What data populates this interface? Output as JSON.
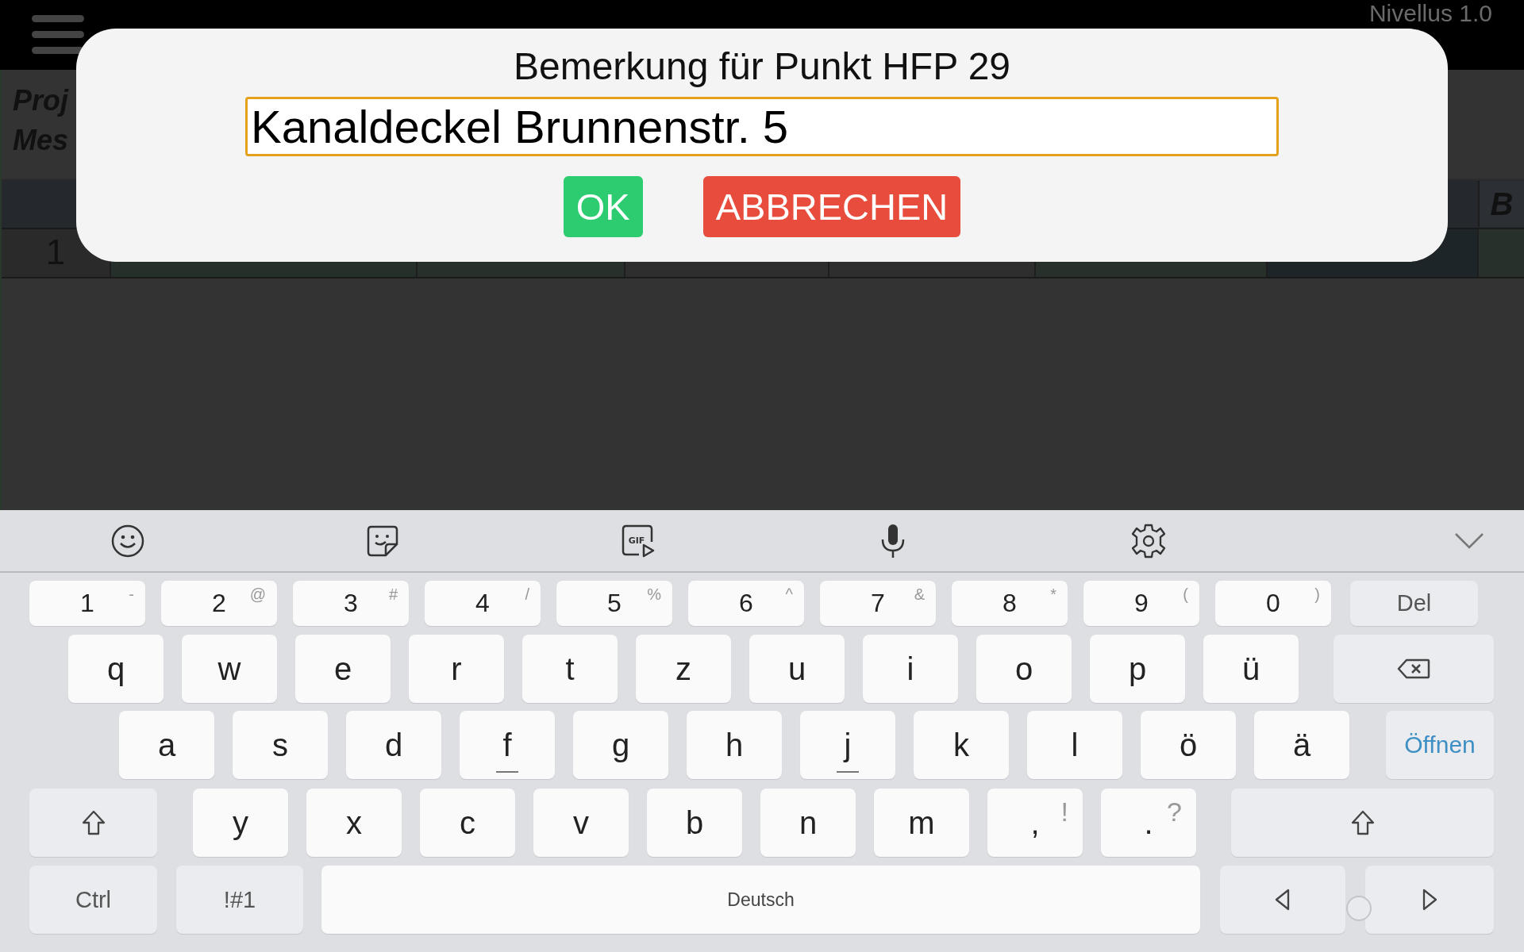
{
  "app_bar": {
    "title": "Nivellus 1.0"
  },
  "background": {
    "info_lines": [
      "Proj",
      "Mes"
    ],
    "header_cells": [
      "B"
    ],
    "row_number": "1"
  },
  "dialog": {
    "title": "Bemerkung für Punkt HFP 29",
    "value": "Kanaldeckel Brunnenstr. 5",
    "buttons": [
      {
        "label": "OK",
        "kind": "confirm"
      },
      {
        "label": "ABBRECHEN",
        "kind": "cancel"
      }
    ]
  },
  "keyboard_toolbar": [
    {
      "kind": "emoji"
    },
    {
      "kind": "sticker"
    },
    {
      "kind": "gif",
      "label": "GIF"
    },
    {
      "kind": "voice"
    },
    {
      "kind": "settings"
    },
    {
      "kind": "collapse"
    }
  ],
  "keyboard_rows": [
    [
      {
        "kind": "char",
        "label": "1",
        "hint": "-"
      },
      {
        "kind": "char",
        "label": "2",
        "hint": "@"
      },
      {
        "kind": "char",
        "label": "3",
        "hint": "#"
      },
      {
        "kind": "char",
        "label": "4",
        "hint": "/"
      },
      {
        "kind": "char",
        "label": "5",
        "hint": "%"
      },
      {
        "kind": "char",
        "label": "6",
        "hint": "^"
      },
      {
        "kind": "char",
        "label": "7",
        "hint": "&"
      },
      {
        "kind": "char",
        "label": "8",
        "hint": "*"
      },
      {
        "kind": "char",
        "label": "9",
        "hint": "("
      },
      {
        "kind": "char",
        "label": "0",
        "hint": ")"
      },
      {
        "kind": "func",
        "label": "Del"
      }
    ],
    [
      {
        "kind": "char",
        "label": "q"
      },
      {
        "kind": "char",
        "label": "w"
      },
      {
        "kind": "char",
        "label": "e"
      },
      {
        "kind": "char",
        "label": "r"
      },
      {
        "kind": "char",
        "label": "t"
      },
      {
        "kind": "char",
        "label": "z"
      },
      {
        "kind": "char",
        "label": "u"
      },
      {
        "kind": "char",
        "label": "i"
      },
      {
        "kind": "char",
        "label": "o"
      },
      {
        "kind": "char",
        "label": "p"
      },
      {
        "kind": "char",
        "label": "ü"
      },
      {
        "kind": "backspace"
      }
    ],
    [
      {
        "kind": "char",
        "label": "a"
      },
      {
        "kind": "char",
        "label": "s"
      },
      {
        "kind": "char",
        "label": "d"
      },
      {
        "kind": "char",
        "label": "f",
        "bump": true
      },
      {
        "kind": "char",
        "label": "g"
      },
      {
        "kind": "char",
        "label": "h"
      },
      {
        "kind": "char",
        "label": "j",
        "bump": true
      },
      {
        "kind": "char",
        "label": "k"
      },
      {
        "kind": "char",
        "label": "l"
      },
      {
        "kind": "char",
        "label": "ö"
      },
      {
        "kind": "char",
        "label": "ä"
      },
      {
        "kind": "action",
        "label": "Öffnen"
      }
    ],
    [
      {
        "kind": "shift"
      },
      {
        "kind": "char",
        "label": "y"
      },
      {
        "kind": "char",
        "label": "x"
      },
      {
        "kind": "char",
        "label": "c"
      },
      {
        "kind": "char",
        "label": "v"
      },
      {
        "kind": "char",
        "label": "b"
      },
      {
        "kind": "char",
        "label": "n"
      },
      {
        "kind": "char",
        "label": "m"
      },
      {
        "kind": "char",
        "label": ",",
        "hint": "!"
      },
      {
        "kind": "char",
        "label": ".",
        "hint": "?"
      },
      {
        "kind": "shift"
      }
    ],
    [
      {
        "kind": "func",
        "label": "Ctrl"
      },
      {
        "kind": "func",
        "label": "!#1"
      },
      {
        "kind": "space",
        "label": "Deutsch"
      },
      {
        "kind": "left"
      },
      {
        "kind": "right"
      }
    ]
  ]
}
